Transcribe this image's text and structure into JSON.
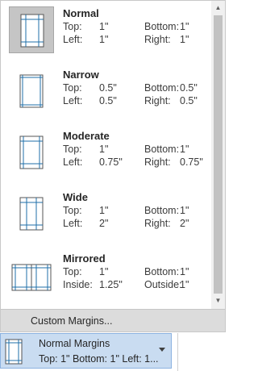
{
  "presets": [
    {
      "name": "Normal",
      "l1": "Top:",
      "v1": "1\"",
      "l2": "Bottom:",
      "v2": "1\"",
      "l3": "Left:",
      "v3": "1\"",
      "l4": "Right:",
      "v4": "1\"",
      "icon": "normal-margins-icon",
      "selected": true
    },
    {
      "name": "Narrow",
      "l1": "Top:",
      "v1": "0.5\"",
      "l2": "Bottom:",
      "v2": "0.5\"",
      "l3": "Left:",
      "v3": "0.5\"",
      "l4": "Right:",
      "v4": "0.5\"",
      "icon": "narrow-margins-icon",
      "selected": false
    },
    {
      "name": "Moderate",
      "l1": "Top:",
      "v1": "1\"",
      "l2": "Bottom:",
      "v2": "1\"",
      "l3": "Left:",
      "v3": "0.75\"",
      "l4": "Right:",
      "v4": "0.75\"",
      "icon": "moderate-margins-icon",
      "selected": false
    },
    {
      "name": "Wide",
      "l1": "Top:",
      "v1": "1\"",
      "l2": "Bottom:",
      "v2": "1\"",
      "l3": "Left:",
      "v3": "2\"",
      "l4": "Right:",
      "v4": "2\"",
      "icon": "wide-margins-icon",
      "selected": false
    },
    {
      "name": "Mirrored",
      "l1": "Top:",
      "v1": "1\"",
      "l2": "Bottom:",
      "v2": "1\"",
      "l3": "Inside:",
      "v3": "1.25\"",
      "l4": "Outside:",
      "v4": "1\"",
      "icon": "mirrored-margins-icon",
      "selected": false
    }
  ],
  "custom_margins_label": "Custom Margins...",
  "gallery_button": {
    "title": "Normal Margins",
    "summary": "Top: 1\" Bottom: 1\" Left: 1..."
  },
  "colors": {
    "selected_bg": "#c5c5c5",
    "button_bg": "#c9dcf1",
    "accent": "#1f6fa8"
  }
}
